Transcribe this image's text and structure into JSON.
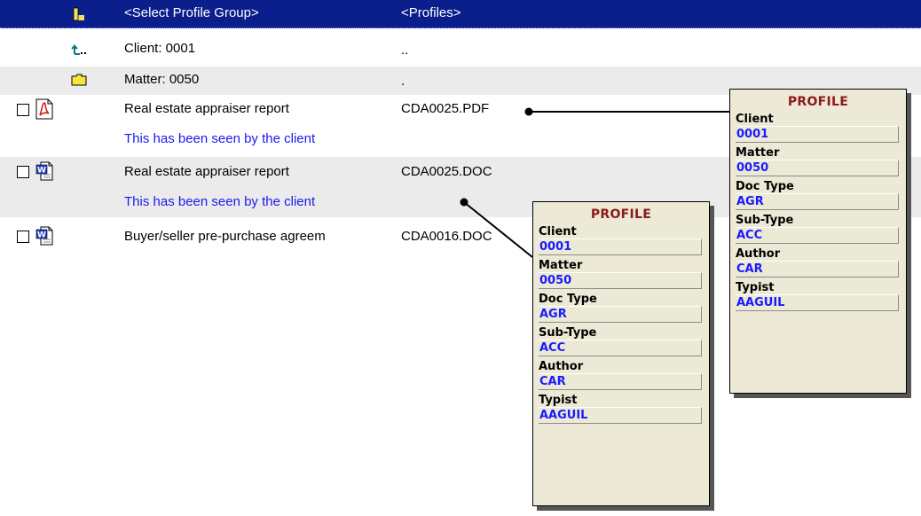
{
  "header": {
    "group_label": "<Select Profile Group>",
    "profiles_label": "<Profiles>"
  },
  "nav_rows": [
    {
      "desc": "Client: 0001",
      "file": "..",
      "icon": "up-folder-icon"
    },
    {
      "desc": "Matter: 0050",
      "file": ".",
      "icon": "folder-icon"
    }
  ],
  "documents": [
    {
      "desc": "Real estate appraiser report",
      "file": "CDA0025.PDF",
      "note": "This has been seen by the client",
      "icon": "pdf-file-icon"
    },
    {
      "desc": "Real estate appraiser report",
      "file": "CDA0025.DOC",
      "note": "This has been seen by the client",
      "icon": "word-doc-icon"
    },
    {
      "desc": "Buyer/seller pre-purchase agreem",
      "file": "CDA0016.DOC",
      "icon": "word-doc-icon"
    }
  ],
  "profile_pdf": {
    "title": "PROFILE",
    "fields": [
      {
        "label": "Client",
        "value": "0001"
      },
      {
        "label": "Matter",
        "value": "0050"
      },
      {
        "label": "Doc Type",
        "value": "AGR"
      },
      {
        "label": "Sub-Type",
        "value": "ACC"
      },
      {
        "label": "Author",
        "value": "CAR"
      },
      {
        "label": "Typist",
        "value": "AAGUIL"
      }
    ]
  },
  "profile_doc": {
    "title": "PROFILE",
    "fields": [
      {
        "label": "Client",
        "value": "0001"
      },
      {
        "label": "Matter",
        "value": "0050"
      },
      {
        "label": "Doc Type",
        "value": "AGR"
      },
      {
        "label": "Sub-Type",
        "value": "ACC"
      },
      {
        "label": "Author",
        "value": "CAR"
      },
      {
        "label": "Typist",
        "value": "AAGUIL"
      }
    ]
  },
  "colors": {
    "header_bg": "#0a1e8c",
    "note_text": "#1a1af0",
    "profile_title": "#8b1a1a",
    "profile_value": "#1a1aff",
    "popup_bg": "#ece9d6"
  }
}
